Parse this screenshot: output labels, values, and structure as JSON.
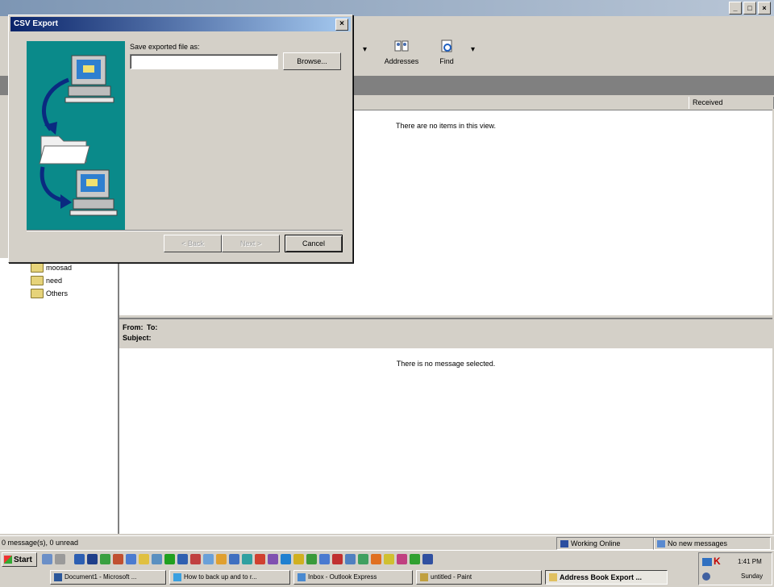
{
  "outlook": {
    "toolbar": {
      "addresses_label": "Addresses",
      "find_label": "Find"
    },
    "list": {
      "received_col": "Received",
      "empty_msg": "There are no items in this view."
    },
    "preview": {
      "from_label": "From:",
      "to_label": "To:",
      "subject_label": "Subject:",
      "empty_msg": "There is no message selected."
    },
    "folders": [
      {
        "label": "moosad"
      },
      {
        "label": "need"
      },
      {
        "label": "Others"
      }
    ],
    "status": {
      "message_count": "0 message(s), 0 unread",
      "online": "Working Online",
      "new_messages": "No new messages"
    }
  },
  "dialog": {
    "title": "CSV Export",
    "save_label": "Save exported file as:",
    "path_value": "",
    "browse_label": "Browse...",
    "back_label": "< Back",
    "next_label": "Next >",
    "cancel_label": "Cancel"
  },
  "taskbar": {
    "start_label": "Start",
    "tasks": [
      {
        "label": "Document1 - Microsoft ..."
      },
      {
        "label": "How to back up and to r..."
      },
      {
        "label": "Inbox - Outlook Express"
      },
      {
        "label": "untitled - Paint"
      },
      {
        "label": "Address Book Export ..."
      }
    ],
    "clock": "1:41 PM",
    "day": "Sunday"
  },
  "colors": {
    "dialog_title": "#0a246a",
    "wizard_art": "#0a8a8a",
    "face": "#d4d0c8"
  }
}
